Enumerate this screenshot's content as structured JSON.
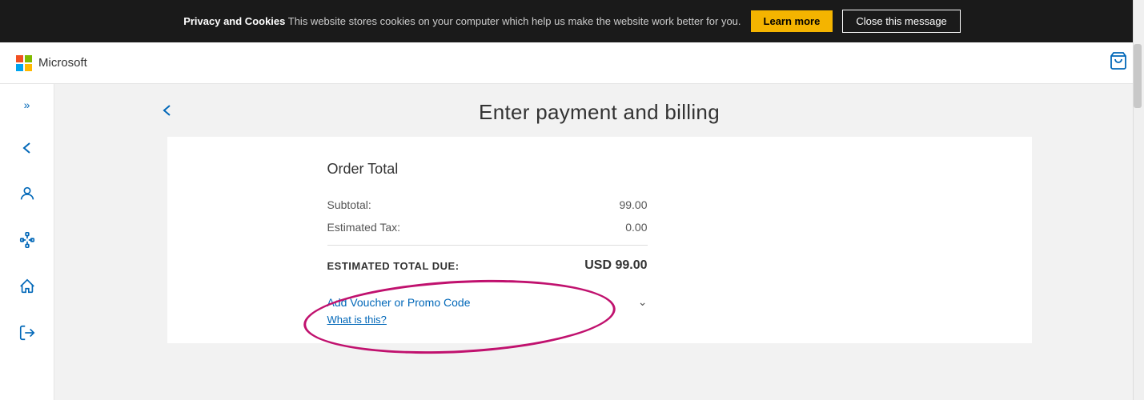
{
  "cookie_banner": {
    "bold_text": "Privacy and Cookies",
    "message": " This website stores cookies on your computer which help us make the website work better for you.",
    "learn_more_label": "Learn more",
    "close_message_label": "Close this message"
  },
  "top_nav": {
    "logo_text": "Microsoft",
    "cart_icon": "🛒"
  },
  "sidebar": {
    "expand_icon": "»",
    "back_icon": "←",
    "person_icon": "👤",
    "network_icon": "⬡",
    "home_icon": "⌂",
    "exit_icon": "→"
  },
  "page": {
    "title": "Enter payment and billing",
    "back_label": "←"
  },
  "order": {
    "heading": "Order Total",
    "subtotal_label": "Subtotal:",
    "subtotal_value": "99.00",
    "tax_label": "Estimated Tax:",
    "tax_value": "0.00",
    "total_label": "ESTIMATED TOTAL DUE:",
    "total_value": "USD 99.00",
    "voucher_label": "Add Voucher or Promo Code",
    "what_is_this_label": "What is this?"
  }
}
